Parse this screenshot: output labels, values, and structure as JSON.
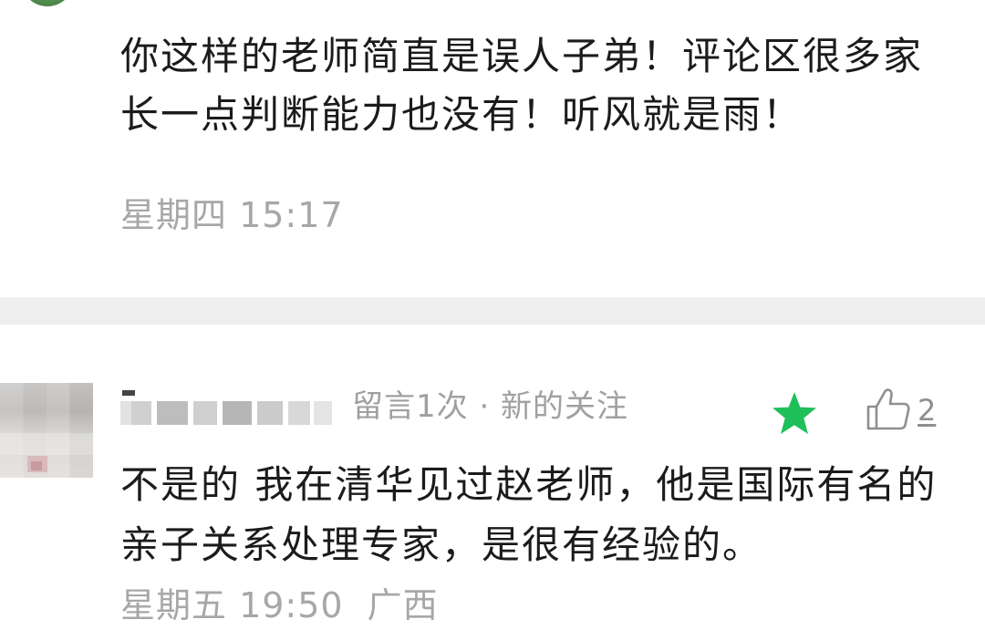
{
  "comment_1": {
    "text": "你这样的老师简直是误人子弟！评论区很多家长一点判断能力也没有！听风就是雨！",
    "time": "星期四 15:17"
  },
  "comment_2": {
    "meta": "留言1次 · 新的关注",
    "like_count": "2",
    "star_color": "#1fbf5a",
    "text": "不是的 我在清华见过赵老师，他是国际有名的亲子关系处理专家，是很有经验的。",
    "time": "星期五 19:50",
    "location": "广西"
  }
}
